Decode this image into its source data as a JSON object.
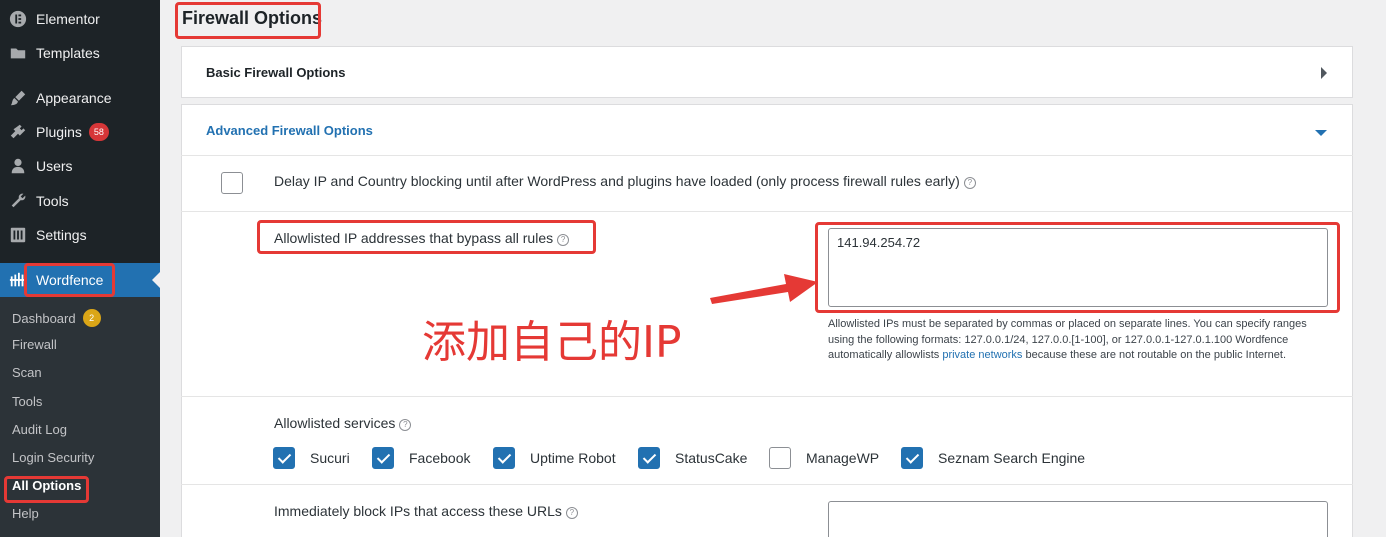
{
  "sidebar": {
    "items": [
      {
        "label": "Elementor",
        "icon": "elementor-icon"
      },
      {
        "label": "Templates",
        "icon": "folder-icon"
      },
      {
        "label": "Appearance",
        "icon": "brush-icon"
      },
      {
        "label": "Plugins",
        "icon": "plugin-icon",
        "badge": "58"
      },
      {
        "label": "Users",
        "icon": "user-icon"
      },
      {
        "label": "Tools",
        "icon": "wrench-icon"
      },
      {
        "label": "Settings",
        "icon": "settings-icon"
      },
      {
        "label": "Wordfence",
        "icon": "wordfence-icon"
      }
    ],
    "submenu": [
      {
        "label": "Dashboard",
        "badge": "2"
      },
      {
        "label": "Firewall"
      },
      {
        "label": "Scan"
      },
      {
        "label": "Tools"
      },
      {
        "label": "Audit Log"
      },
      {
        "label": "Login Security"
      },
      {
        "label": "All Options"
      },
      {
        "label": "Help"
      }
    ]
  },
  "main": {
    "title": "Firewall Options",
    "basic_panel": "Basic Firewall Options",
    "advanced_panel": "Advanced Firewall Options",
    "delay_option": "Delay IP and Country blocking until after WordPress and plugins have loaded (only process firewall rules early)",
    "allowlist_label": "Allowlisted IP addresses that bypass all rules",
    "allowlist_value": "141.94.254.72",
    "allowlist_hint": "Allowlisted IPs must be separated by commas or placed on separate lines. You can specify ranges using the following formats: 127.0.0.1/24, 127.0.0.[1-100], or 127.0.0.1-127.0.1.100 Wordfence automatically allowlists",
    "allowlist_hint_link": "private networks",
    "allowlist_hint_tail": "because these are not routable on the public Internet.",
    "services_label": "Allowlisted services",
    "services": [
      {
        "label": "Sucuri",
        "checked": true
      },
      {
        "label": "Facebook",
        "checked": true
      },
      {
        "label": "Uptime Robot",
        "checked": true
      },
      {
        "label": "StatusCake",
        "checked": true
      },
      {
        "label": "ManageWP",
        "checked": false
      },
      {
        "label": "Seznam Search Engine",
        "checked": true
      }
    ],
    "block_urls_label": "Immediately block IPs that access these URLs"
  },
  "annotation": {
    "text": "添加自己的IP",
    "color": "#e53935"
  },
  "colors": {
    "sidebar_bg": "#1d2327",
    "accent": "#2271b1",
    "highlight": "#e53935"
  }
}
